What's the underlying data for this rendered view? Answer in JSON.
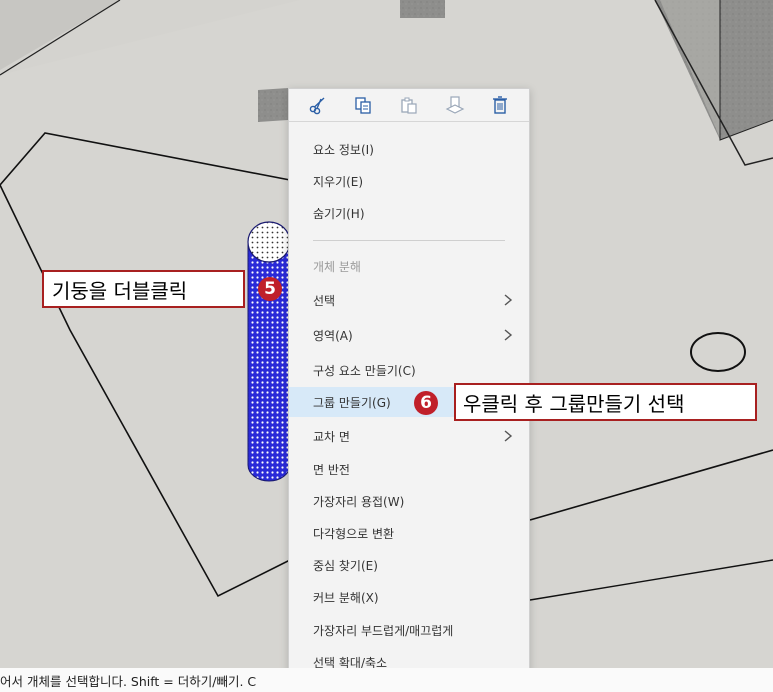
{
  "toolbar": {
    "buttons": [
      {
        "icon": "scissors-icon",
        "label": "cut"
      },
      {
        "icon": "copy-icon",
        "label": "copy"
      },
      {
        "icon": "paste-icon",
        "label": "paste"
      },
      {
        "icon": "paste-in-place-icon",
        "label": "paste in place"
      },
      {
        "icon": "trash-icon",
        "label": "delete"
      }
    ]
  },
  "menu": {
    "items": [
      {
        "label": "요소 정보(I)",
        "disabled": false,
        "submenu": false
      },
      {
        "label": "지우기(E)",
        "disabled": false,
        "submenu": false
      },
      {
        "label": "숨기기(H)",
        "disabled": false,
        "submenu": false
      },
      {
        "label": "개체 분해",
        "disabled": true,
        "submenu": false
      },
      {
        "label": "선택",
        "disabled": false,
        "submenu": true
      },
      {
        "label": "영역(A)",
        "disabled": false,
        "submenu": true
      },
      {
        "label": "구성 요소 만들기(C)",
        "disabled": false,
        "submenu": false
      },
      {
        "label": "그룹 만들기(G)",
        "disabled": false,
        "submenu": false,
        "highlighted": true
      },
      {
        "label": "교차 면",
        "disabled": false,
        "submenu": true
      },
      {
        "label": "면 반전",
        "disabled": false,
        "submenu": false
      },
      {
        "label": "가장자리 용접(W)",
        "disabled": false,
        "submenu": false
      },
      {
        "label": "다각형으로 변환",
        "disabled": false,
        "submenu": false
      },
      {
        "label": "중심 찾기(E)",
        "disabled": false,
        "submenu": false
      },
      {
        "label": "커브 분해(X)",
        "disabled": false,
        "submenu": false
      },
      {
        "label": "가장자리 부드럽게/매끄럽게",
        "disabled": false,
        "submenu": false
      },
      {
        "label": "선택 확대/축소",
        "disabled": false,
        "submenu": false
      }
    ]
  },
  "callouts": {
    "step5": {
      "text": "기둥을 더블클릭",
      "badge": "5"
    },
    "step6": {
      "text": "우클릭 후 그룹만들기 선택",
      "badge": "6"
    }
  },
  "status": {
    "text": "어서 개체를 선택합니다. Shift = 더하기/빼기. C"
  },
  "colors": {
    "accent_red": "#c0202a",
    "highlight": "#d7e9f8",
    "column_blue": "#2a2ad8"
  }
}
